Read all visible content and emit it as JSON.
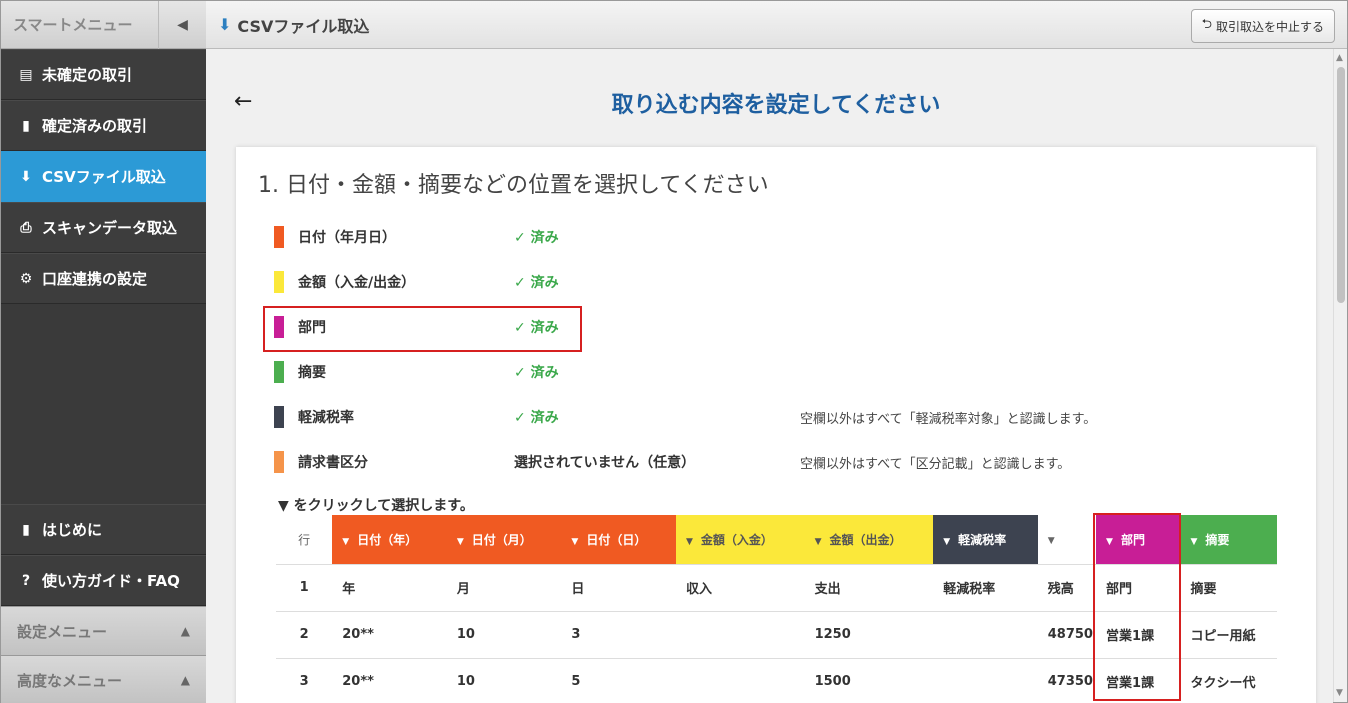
{
  "sidebar": {
    "top_label": "スマートメニュー",
    "collapse_icon": "◀",
    "items": [
      {
        "icon": "▤",
        "label": "未確定の取引",
        "active": false
      },
      {
        "icon": "▮",
        "label": "確定済みの取引",
        "active": false
      },
      {
        "icon": "⬇",
        "label": "CSVファイル取込",
        "active": true
      },
      {
        "icon": "⎙",
        "label": "スキャンデータ取込",
        "active": false
      },
      {
        "icon": "⚙",
        "label": "口座連携の設定",
        "active": false
      }
    ],
    "bottom_items": [
      {
        "icon": "▮",
        "label": "はじめに"
      },
      {
        "icon": "?",
        "label": "使い方ガイド・FAQ"
      }
    ],
    "sub_menus": [
      {
        "label": "設定メニュー"
      },
      {
        "label": "高度なメニュー"
      }
    ]
  },
  "header": {
    "title": "CSVファイル取込",
    "stop_button": "取引取込を中止する"
  },
  "page": {
    "back": "←",
    "title": "取り込む内容を設定してください",
    "section_title": "1. 日付・金額・摘要などの位置を選択してください",
    "hint": "▼ をクリックして選択します。"
  },
  "fields": [
    {
      "name": "日付（年月日）",
      "status": "✓ 済み",
      "note": "",
      "color": "#f05a22",
      "done": true
    },
    {
      "name": "金額（入金/出金）",
      "status": "✓ 済み",
      "note": "",
      "color": "#fbe83a",
      "done": true
    },
    {
      "name": "部門",
      "status": "✓ 済み",
      "note": "",
      "color": "#c81e96",
      "done": true
    },
    {
      "name": "摘要",
      "status": "✓ 済み",
      "note": "",
      "color": "#4cae4f",
      "done": true
    },
    {
      "name": "軽減税率",
      "status": "✓ 済み",
      "note": "空欄以外はすべて「軽減税率対象」と認識します。",
      "color": "#3d4350",
      "done": true
    },
    {
      "name": "請求書区分",
      "status": "選択されていません（任意）",
      "note": "空欄以外はすべて「区分記載」と認識します。",
      "color": "#f5944a",
      "done": false
    }
  ],
  "grid": {
    "row_header": "行",
    "columns": [
      {
        "label": "日付（年）",
        "kind": "date"
      },
      {
        "label": "日付（月）",
        "kind": "date"
      },
      {
        "label": "日付（日）",
        "kind": "date"
      },
      {
        "label": "金額（入金）",
        "kind": "amt"
      },
      {
        "label": "金額（出金）",
        "kind": "amt"
      },
      {
        "label": "軽減税率",
        "kind": "tax"
      },
      {
        "label": "",
        "kind": "none"
      },
      {
        "label": "部門",
        "kind": "dept"
      },
      {
        "label": "摘要",
        "kind": "memo"
      }
    ],
    "rows": [
      {
        "no": "1",
        "cells": [
          "年",
          "月",
          "日",
          "収入",
          "支出",
          "軽減税率",
          "残高",
          "部門",
          "摘要"
        ]
      },
      {
        "no": "2",
        "cells": [
          "20**",
          "10",
          "3",
          "",
          "1250",
          "",
          "48750",
          "営業1課",
          "コピー用紙"
        ]
      },
      {
        "no": "3",
        "cells": [
          "20**",
          "10",
          "5",
          "",
          "1500",
          "",
          "47350",
          "営業1課",
          "タクシー代"
        ]
      }
    ]
  }
}
